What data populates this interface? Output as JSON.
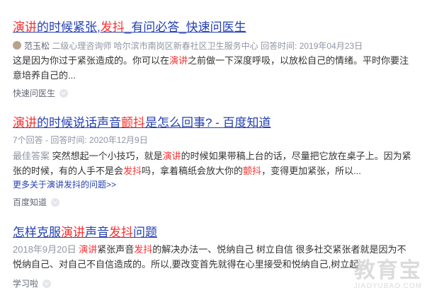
{
  "results": [
    {
      "title": [
        "演讲",
        "的时候紧张,",
        "发抖",
        "_有问必答_快速问医生"
      ],
      "meta_author": "范玉松",
      "meta_rest": " 二级心理咨询师 哈尔滨市南岗区新春社区卫生服务中心 回答时间: 2019年04月23日",
      "abstract": [
        "这是因为你过于紧张造成的。你可以在",
        "演讲",
        "之前做一下深度呼吸，以放松自己的情绪。平时你要注意培养自己的..."
      ],
      "source": "快速问医生"
    },
    {
      "title": [
        "演讲",
        "的时候说话声音",
        "颤抖",
        "是怎么回事? - 百度知道"
      ],
      "meta": "7个回答 - 回答时间: 2020年12月9日",
      "abstract": [
        "最佳答案",
        " 突然想起一个小技巧，就是",
        "演讲",
        "的时候如果带稿上台的话，尽量把它放在桌子上。因为紧张的时候，有的人手不是会",
        "发抖",
        "吗，拿着稿纸会放大你的",
        "颤抖",
        "，变得更加紧张，所以..."
      ],
      "more_link": "更多关于演讲发抖的问题>>",
      "source": "百度知道"
    },
    {
      "title": [
        "怎样克服",
        "演讲",
        "声音",
        "发抖",
        "问题"
      ],
      "meta_date": "2018年9月20日",
      "abstract": [
        "演讲",
        "紧张声音",
        "发抖",
        "的解决办法一、悦纳自己 树立自信 很多社交紧张者就是因为不悦纳自己、对自己不自信造成的。所以,要改变首先就得在心里接受和悦纳自己,树立起"
      ],
      "source": "学习啦"
    }
  ],
  "watermark": {
    "big": "教育宝",
    "small": "JIAOYUBAO.COM"
  }
}
